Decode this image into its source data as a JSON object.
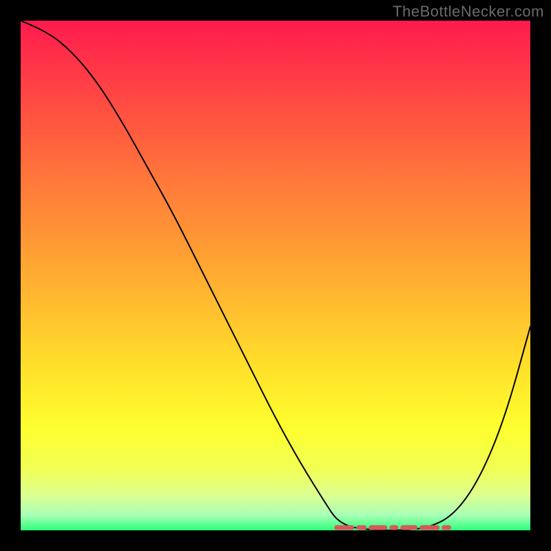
{
  "watermark": "TheBottleNecker.com",
  "colors": {
    "gradient_top": "#ff1a4d",
    "gradient_bottom": "#2fff7a",
    "curve": "#000000",
    "marker": "#d45a5a",
    "frame": "#000000"
  },
  "chart_data": {
    "type": "line",
    "title": "",
    "xlabel": "",
    "ylabel": "",
    "xlim": [
      0,
      100
    ],
    "ylim": [
      0,
      100
    ],
    "series": [
      {
        "name": "bottleneck-curve",
        "x": [
          0,
          5,
          10,
          15,
          20,
          25,
          30,
          35,
          40,
          45,
          50,
          55,
          60,
          62,
          65,
          70,
          75,
          80,
          85,
          90,
          95,
          100
        ],
        "y": [
          100,
          98,
          94,
          88,
          80,
          71,
          62,
          52,
          42,
          32,
          22,
          13,
          5,
          2,
          0.5,
          0,
          0,
          0.5,
          3,
          10,
          22,
          40
        ]
      }
    ],
    "marker_region": {
      "name": "optimum-range",
      "x_start": 62,
      "x_end": 84,
      "y": 0
    },
    "annotations": []
  }
}
